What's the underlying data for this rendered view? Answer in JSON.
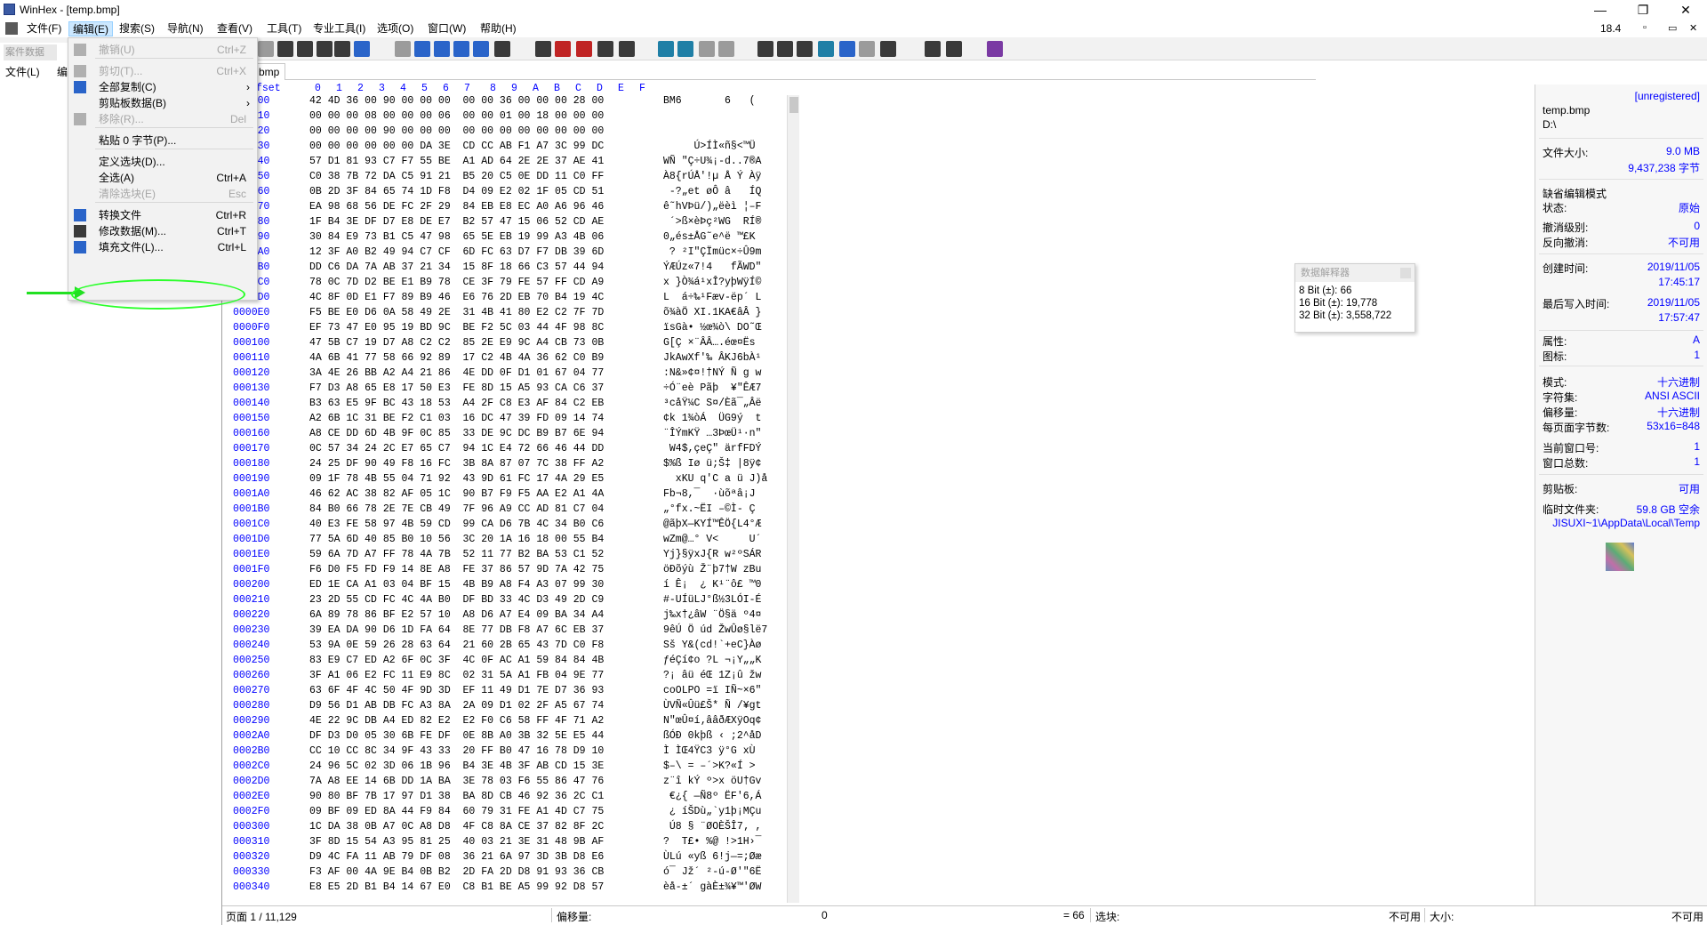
{
  "window": {
    "title": "WinHex - [temp.bmp]",
    "controls": [
      "—",
      "❐",
      "✕"
    ]
  },
  "menubar": {
    "items": [
      "文件(F)",
      "编辑(E)",
      "搜索(S)",
      "导航(N)",
      "查看(V)",
      "工具(T)",
      "专业工具(I)",
      "选项(O)",
      "窗口(W)",
      "帮助(H)"
    ],
    "zoom": "18.4"
  },
  "left_panel": {
    "header": "案件数据",
    "menu": [
      "文件(L)",
      "编"
    ]
  },
  "tab": {
    "label": "bmp"
  },
  "hex": {
    "offset_header": "fset",
    "col_headers": [
      "0",
      "1",
      "2",
      "3",
      "4",
      "5",
      "6",
      "7",
      "8",
      "9",
      "A",
      "B",
      "C",
      "D",
      "E",
      "F"
    ],
    "rows": [
      {
        "off": "000000",
        "bytes": "42 4D 36 00 90 00 00 00  00 00 36 00 00 00 28 00",
        "asc": "BM6       6   ("
      },
      {
        "off": "000010",
        "bytes": "00 00 00 08 00 00 00 06  00 00 01 00 18 00 00 00",
        "asc": ""
      },
      {
        "off": "000020",
        "bytes": "00 00 00 00 90 00 00 00  00 00 00 00 00 00 00 00",
        "asc": ""
      },
      {
        "off": "000030",
        "bytes": "00 00 00 00 00 00 DA 3E  CD CC AB F1 A7 3C 99 DC",
        "asc": "     Ú>ÍÌ«ñ§<™Ü"
      },
      {
        "off": "000040",
        "bytes": "57 D1 81 93 C7 F7 55 BE  A1 AD 64 2E 2E 37 AE 41",
        "asc": "WÑ \"Ç÷U¾¡-d..7®A"
      },
      {
        "off": "000050",
        "bytes": "C0 38 7B 72 DA C5 91 21  B5 20 C5 0E DD 11 C0 FF",
        "asc": "À8{rÚÅ'!µ Å Ý Àÿ"
      },
      {
        "off": "000060",
        "bytes": "0B 2D 3F 84 65 74 1D F8  D4 09 E2 02 1F 05 CD 51",
        "asc": " -?„et øÔ â   ÍQ"
      },
      {
        "off": "000070",
        "bytes": "EA 98 68 56 DE FC 2F 29  84 EB E8 EC A0 A6 96 46",
        "asc": "ê˜hVÞü/)„ëèì ¦–F"
      },
      {
        "off": "000080",
        "bytes": "1F B4 3E DF D7 E8 DE E7  B2 57 47 15 06 52 CD AE",
        "asc": " ´>ß×èÞç²WG  RÍ®"
      },
      {
        "off": "000090",
        "bytes": "30 84 E9 73 B1 C5 47 98  65 5E EB 19 99 A3 4B 06",
        "asc": "0„és±ÅG˜e^ë ™£K "
      },
      {
        "off": "0000A0",
        "bytes": "12 3F A0 B2 49 94 C7 CF  6D FC 63 D7 F7 DB 39 6D",
        "asc": " ? ²I\"ÇÏmüc×÷Û9m"
      },
      {
        "off": "0000B0",
        "bytes": "DD C6 DA 7A AB 37 21 34  15 8F 18 66 C3 57 44 94",
        "asc": "ÝÆÚz«7!4   fÃWD\""
      },
      {
        "off": "0000C0",
        "bytes": "78 0C 7D D2 BE E1 B9 78  CE 3F 79 FE 57 FF CD A9",
        "asc": "x }Ò¾á¹xÎ?yþWÿÍ©"
      },
      {
        "off": "0000D0",
        "bytes": "4C 8F 0D E1 F7 89 B9 46  E6 76 2D EB 70 B4 19 4C",
        "asc": "L  á÷‰¹Fæv-ëp´ L"
      },
      {
        "off": "0000E0",
        "bytes": "F5 BE E0 D6 0A 58 49 2E  31 4B 41 80 E2 C2 7F 7D",
        "asc": "õ¾àÖ XI.1KA€âÂ }"
      },
      {
        "off": "0000F0",
        "bytes": "EF 73 47 E0 95 19 BD 9C  BE F2 5C 03 44 4F 98 8C",
        "asc": "ïsGà• ½œ¾ò\\ DO˜Œ"
      },
      {
        "off": "000100",
        "bytes": "47 5B C7 19 D7 A8 C2 C2  85 2E E9 9C A4 CB 73 0B",
        "asc": "G[Ç ×¨ÂÂ….éœ¤Ës "
      },
      {
        "off": "000110",
        "bytes": "4A 6B 41 77 58 66 92 89  17 C2 4B 4A 36 62 C0 B9",
        "asc": "JkAwXf'‰ ÂKJ6bÀ¹"
      },
      {
        "off": "000120",
        "bytes": "3A 4E 26 BB A2 A4 21 86  4E DD 0F D1 01 67 04 77",
        "asc": ":N&»¢¤!†NÝ Ñ g w"
      },
      {
        "off": "000130",
        "bytes": "F7 D3 A8 65 E8 17 50 E3  FE 8D 15 A5 93 CA C6 37",
        "asc": "÷Ó¨eè Pãþ  ¥\"ÊÆ7"
      },
      {
        "off": "000140",
        "bytes": "B3 63 E5 9F BC 43 18 53  A4 2F C8 E3 AF 84 C2 EB",
        "asc": "³cåŸ¼C S¤/Èã¯„Âë"
      },
      {
        "off": "000150",
        "bytes": "A2 6B 1C 31 BE F2 C1 03  16 DC 47 39 FD 09 14 74",
        "asc": "¢k 1¾òÁ  ÜG9ý  t"
      },
      {
        "off": "000160",
        "bytes": "A8 CE DD 6D 4B 9F 0C 85  33 DE 9C DC B9 B7 6E 94",
        "asc": "¨ÎÝmKŸ …3ÞœÜ¹·n\""
      },
      {
        "off": "000170",
        "bytes": "0C 57 34 24 2C E7 65 C7  94 1C E4 72 66 46 44 DD",
        "asc": " W4$,çeÇ\" ärfFDÝ"
      },
      {
        "off": "000180",
        "bytes": "24 25 DF 90 49 F8 16 FC  3B 8A 87 07 7C 38 FF A2",
        "asc": "$%ß Iø ü;Š‡ |8ÿ¢"
      },
      {
        "off": "000190",
        "bytes": "09 1F 78 4B 55 04 71 92  43 9D 61 FC 17 4A 29 E5",
        "asc": "  xKU q'C a ü J)å"
      },
      {
        "off": "0001A0",
        "bytes": "46 62 AC 38 82 AF 05 1C  90 B7 F9 F5 AA E2 A1 4A",
        "asc": "Fb¬8,¯  ·ùõªâ¡J"
      },
      {
        "off": "0001B0",
        "bytes": "84 B0 66 78 2E 7E CB 49  7F 96 A9 CC AD 81 C7 04",
        "asc": "„°fx.~ËI –©Ì- Ç "
      },
      {
        "off": "0001C0",
        "bytes": "40 E3 FE 58 97 4B 59 CD  99 CA D6 7B 4C 34 B0 C6",
        "asc": "@ãþX—KYÍ™ÊÖ{L4°Æ"
      },
      {
        "off": "0001D0",
        "bytes": "77 5A 6D 40 85 B0 10 56  3C 20 1A 16 18 00 55 B4",
        "asc": "wZm@…° V<     U´"
      },
      {
        "off": "0001E0",
        "bytes": "59 6A 7D A7 FF 78 4A 7B  52 11 77 B2 BA 53 C1 52",
        "asc": "Yj}§ÿxJ{R w²ºSÁR"
      },
      {
        "off": "0001F0",
        "bytes": "F6 D0 F5 FD F9 14 8E A8  FE 37 86 57 9D 7A 42 75",
        "asc": "öÐõýù Ž¨þ7†W zBu"
      },
      {
        "off": "000200",
        "bytes": "ED 1E CA A1 03 04 BF 15  4B B9 A8 F4 A3 07 99 30",
        "asc": "í Ê¡  ¿ K¹¨ô£ ™0"
      },
      {
        "off": "000210",
        "bytes": "23 2D 55 CD FC 4C 4A B0  DF BD 33 4C D3 49 2D C9",
        "asc": "#-UÍüLJ°ß½3LÓI-É"
      },
      {
        "off": "000220",
        "bytes": "6A 89 78 86 BF E2 57 10  A8 D6 A7 E4 09 BA 34 A4",
        "asc": "j‰x†¿âW ¨Ö§ä º4¤"
      },
      {
        "off": "000230",
        "bytes": "39 EA DA 90 D6 1D FA 64  8E 77 DB F8 A7 6C EB 37",
        "asc": "9êÚ Ö úd ŽwÛø§lë7"
      },
      {
        "off": "000240",
        "bytes": "53 9A 0E 59 26 28 63 64  21 60 2B 65 43 7D C0 F8",
        "asc": "Sš Y&(cd!`+eC}Àø"
      },
      {
        "off": "000250",
        "bytes": "83 E9 C7 ED A2 6F 0C 3F  4C 0F AC A1 59 84 84 4B",
        "asc": "ƒéÇí¢o ?L ¬¡Y„„K"
      },
      {
        "off": "000260",
        "bytes": "3F A1 06 E2 FC 11 E9 8C  02 31 5A A1 FB 04 9E 77",
        "asc": "?¡ âü éŒ 1Z¡û žw"
      },
      {
        "off": "000270",
        "bytes": "63 6F 4F 4C 50 4F 9D 3D  EF 11 49 D1 7E D7 36 93",
        "asc": "coOLPO =ï IÑ~×6\""
      },
      {
        "off": "000280",
        "bytes": "D9 56 D1 AB DB FC A3 8A  2A 09 D1 02 2F A5 67 74",
        "asc": "ÙVÑ«Ûü£Š* Ñ /¥gt"
      },
      {
        "off": "000290",
        "bytes": "4E 22 9C DB A4 ED 82 E2  E2 F0 C6 58 FF 4F 71 A2",
        "asc": "N\"œÛ¤í‚ââðÆXÿOq¢"
      },
      {
        "off": "0002A0",
        "bytes": "DF D3 D0 05 30 6B FE DF  0E 8B A0 3B 32 5E E5 44",
        "asc": "ßÓÐ 0kþß ‹ ;2^åD"
      },
      {
        "off": "0002B0",
        "bytes": "CC 10 CC 8C 34 9F 43 33  20 FF B0 47 16 78 D9 10",
        "asc": "Ì ÌŒ4ŸC3 ÿ°G xÙ "
      },
      {
        "off": "0002C0",
        "bytes": "24 96 5C 02 3D 06 1B 96  B4 3E 4B 3F AB CD 15 3E",
        "asc": "$–\\ = –´>K?«Í >"
      },
      {
        "off": "0002D0",
        "bytes": "7A A8 EE 14 6B DD 1A BA  3E 78 03 F6 55 86 47 76",
        "asc": "z¨î kÝ º>x öU†Gv"
      },
      {
        "off": "0002E0",
        "bytes": "90 80 BF 7B 17 97 D1 38  BA 8D CB 46 92 36 2C C1",
        "asc": " €¿{ —Ñ8º ËF'6,Á"
      },
      {
        "off": "0002F0",
        "bytes": "09 BF 09 ED 8A 44 F9 84  60 79 31 FE A1 4D C7 75",
        "asc": " ¿ íŠDù„`y1þ¡MÇu"
      },
      {
        "off": "000300",
        "bytes": "1C DA 38 0B A7 0C A8 D8  4F C8 8A CE 37 82 8F 2C",
        "asc": " Ú8 § ¨ØOÈŠÎ7‚ ,"
      },
      {
        "off": "000310",
        "bytes": "3F 8D 15 54 A3 95 81 25  40 03 21 3E 31 48 9B AF",
        "asc": "?  T£• %@ !>1H›¯"
      },
      {
        "off": "000320",
        "bytes": "D9 4C FA 11 AB 79 DF 08  36 21 6A 97 3D 3B D8 E6",
        "asc": "ÙLú «yß 6!j—=;Øæ"
      },
      {
        "off": "000330",
        "bytes": "F3 AF 00 4A 9E B4 0B B2  2D FA 2D D8 91 93 36 CB",
        "asc": "ó¯ Jž´ ²-ú-Ø'\"6Ë"
      },
      {
        "off": "000340",
        "bytes": "E8 E5 2D B1 B4 14 67 E0  C8 B1 BE A5 99 92 D8 57",
        "asc": "èå-±´ gàÈ±¾¥™'ØW"
      }
    ]
  },
  "edit_menu": {
    "items": [
      {
        "label": "撤销(U)",
        "shortcut": "Ctrl+Z",
        "disabled": true,
        "icon": "undo-icon"
      },
      {
        "sep": true
      },
      {
        "label": "剪切(T)...",
        "shortcut": "Ctrl+X",
        "disabled": true,
        "icon": "cut-icon"
      },
      {
        "label": "全部复制(C)",
        "arrow": "›",
        "icon": "copy-icon"
      },
      {
        "label": "剪贴板数据(B)",
        "arrow": "›",
        "icon": ""
      },
      {
        "label": "移除(R)...",
        "shortcut": "Del",
        "disabled": true,
        "icon": "remove-icon"
      },
      {
        "sep": true
      },
      {
        "label": "粘贴 0 字节(P)...",
        "icon": ""
      },
      {
        "sep": true
      },
      {
        "label": "定义选块(D)...",
        "icon": ""
      },
      {
        "label": "全选(A)",
        "shortcut": "Ctrl+A",
        "icon": ""
      },
      {
        "label": "清除选块(E)",
        "shortcut": "Esc",
        "disabled": true,
        "icon": ""
      },
      {
        "sep": true
      },
      {
        "label": "转换文件",
        "shortcut": "Ctrl+R",
        "icon": "convert-icon"
      },
      {
        "label": "修改数据(M)...",
        "shortcut": "Ctrl+T",
        "icon": "modify-data-icon"
      },
      {
        "label": "填充文件(L)...",
        "shortcut": "Ctrl+L",
        "icon": "fill-icon"
      }
    ]
  },
  "right_panel": {
    "unregistered": "[unregistered]",
    "filename": "temp.bmp",
    "path": "D:\\",
    "file_size_label": "文件大小:",
    "file_size": "9.0 MB",
    "file_bytes": "9,437,238 字节",
    "edit_mode_label": "缺省编辑模式",
    "state_label": "状态:",
    "state": "原始",
    "undo_level_label": "撤消级别:",
    "undo_level": "0",
    "reverse_undo_label": "反向撤消:",
    "reverse_undo": "不可用",
    "created_label": "创建时间:",
    "created_date": "2019/11/05",
    "created_time": "17:45:17",
    "modified_label": "最后写入时间:",
    "modified_date": "2019/11/05",
    "modified_time": "17:57:47",
    "attr_label": "属性:",
    "attr": "A",
    "icon_label": "图标:",
    "icon": "1",
    "mode_label": "模式:",
    "mode": "十六进制",
    "charset_label": "字符集:",
    "charset": "ANSI ASCII",
    "offset_label": "偏移量:",
    "offset": "十六进制",
    "bytes_per_page_label": "每页面字节数:",
    "bytes_per_page": "53x16=848",
    "cur_window_label": "当前窗口号:",
    "cur_window": "1",
    "window_total_label": "窗口总数:",
    "window_total": "1",
    "clipboard_label": "剪贴板:",
    "clipboard": "可用",
    "temp_label": "临时文件夹:",
    "temp_free": "59.8 GB 空余",
    "temp_path": "JISUXI~1\\AppData\\Local\\Temp"
  },
  "interpreter": {
    "title": "数据解释器",
    "b8": "8 Bit (±): 66",
    "b16": "16 Bit (±): 19,778",
    "b32": "32 Bit (±): 3,558,722"
  },
  "statusbar": {
    "page": "页面 1 / 11,129",
    "offset_label": "偏移量:",
    "offset_val": "0",
    "eq": "= 66",
    "sel_label": "选块:",
    "sel_val": "不可用",
    "size_label": "大小:",
    "size_val": "不可用"
  }
}
